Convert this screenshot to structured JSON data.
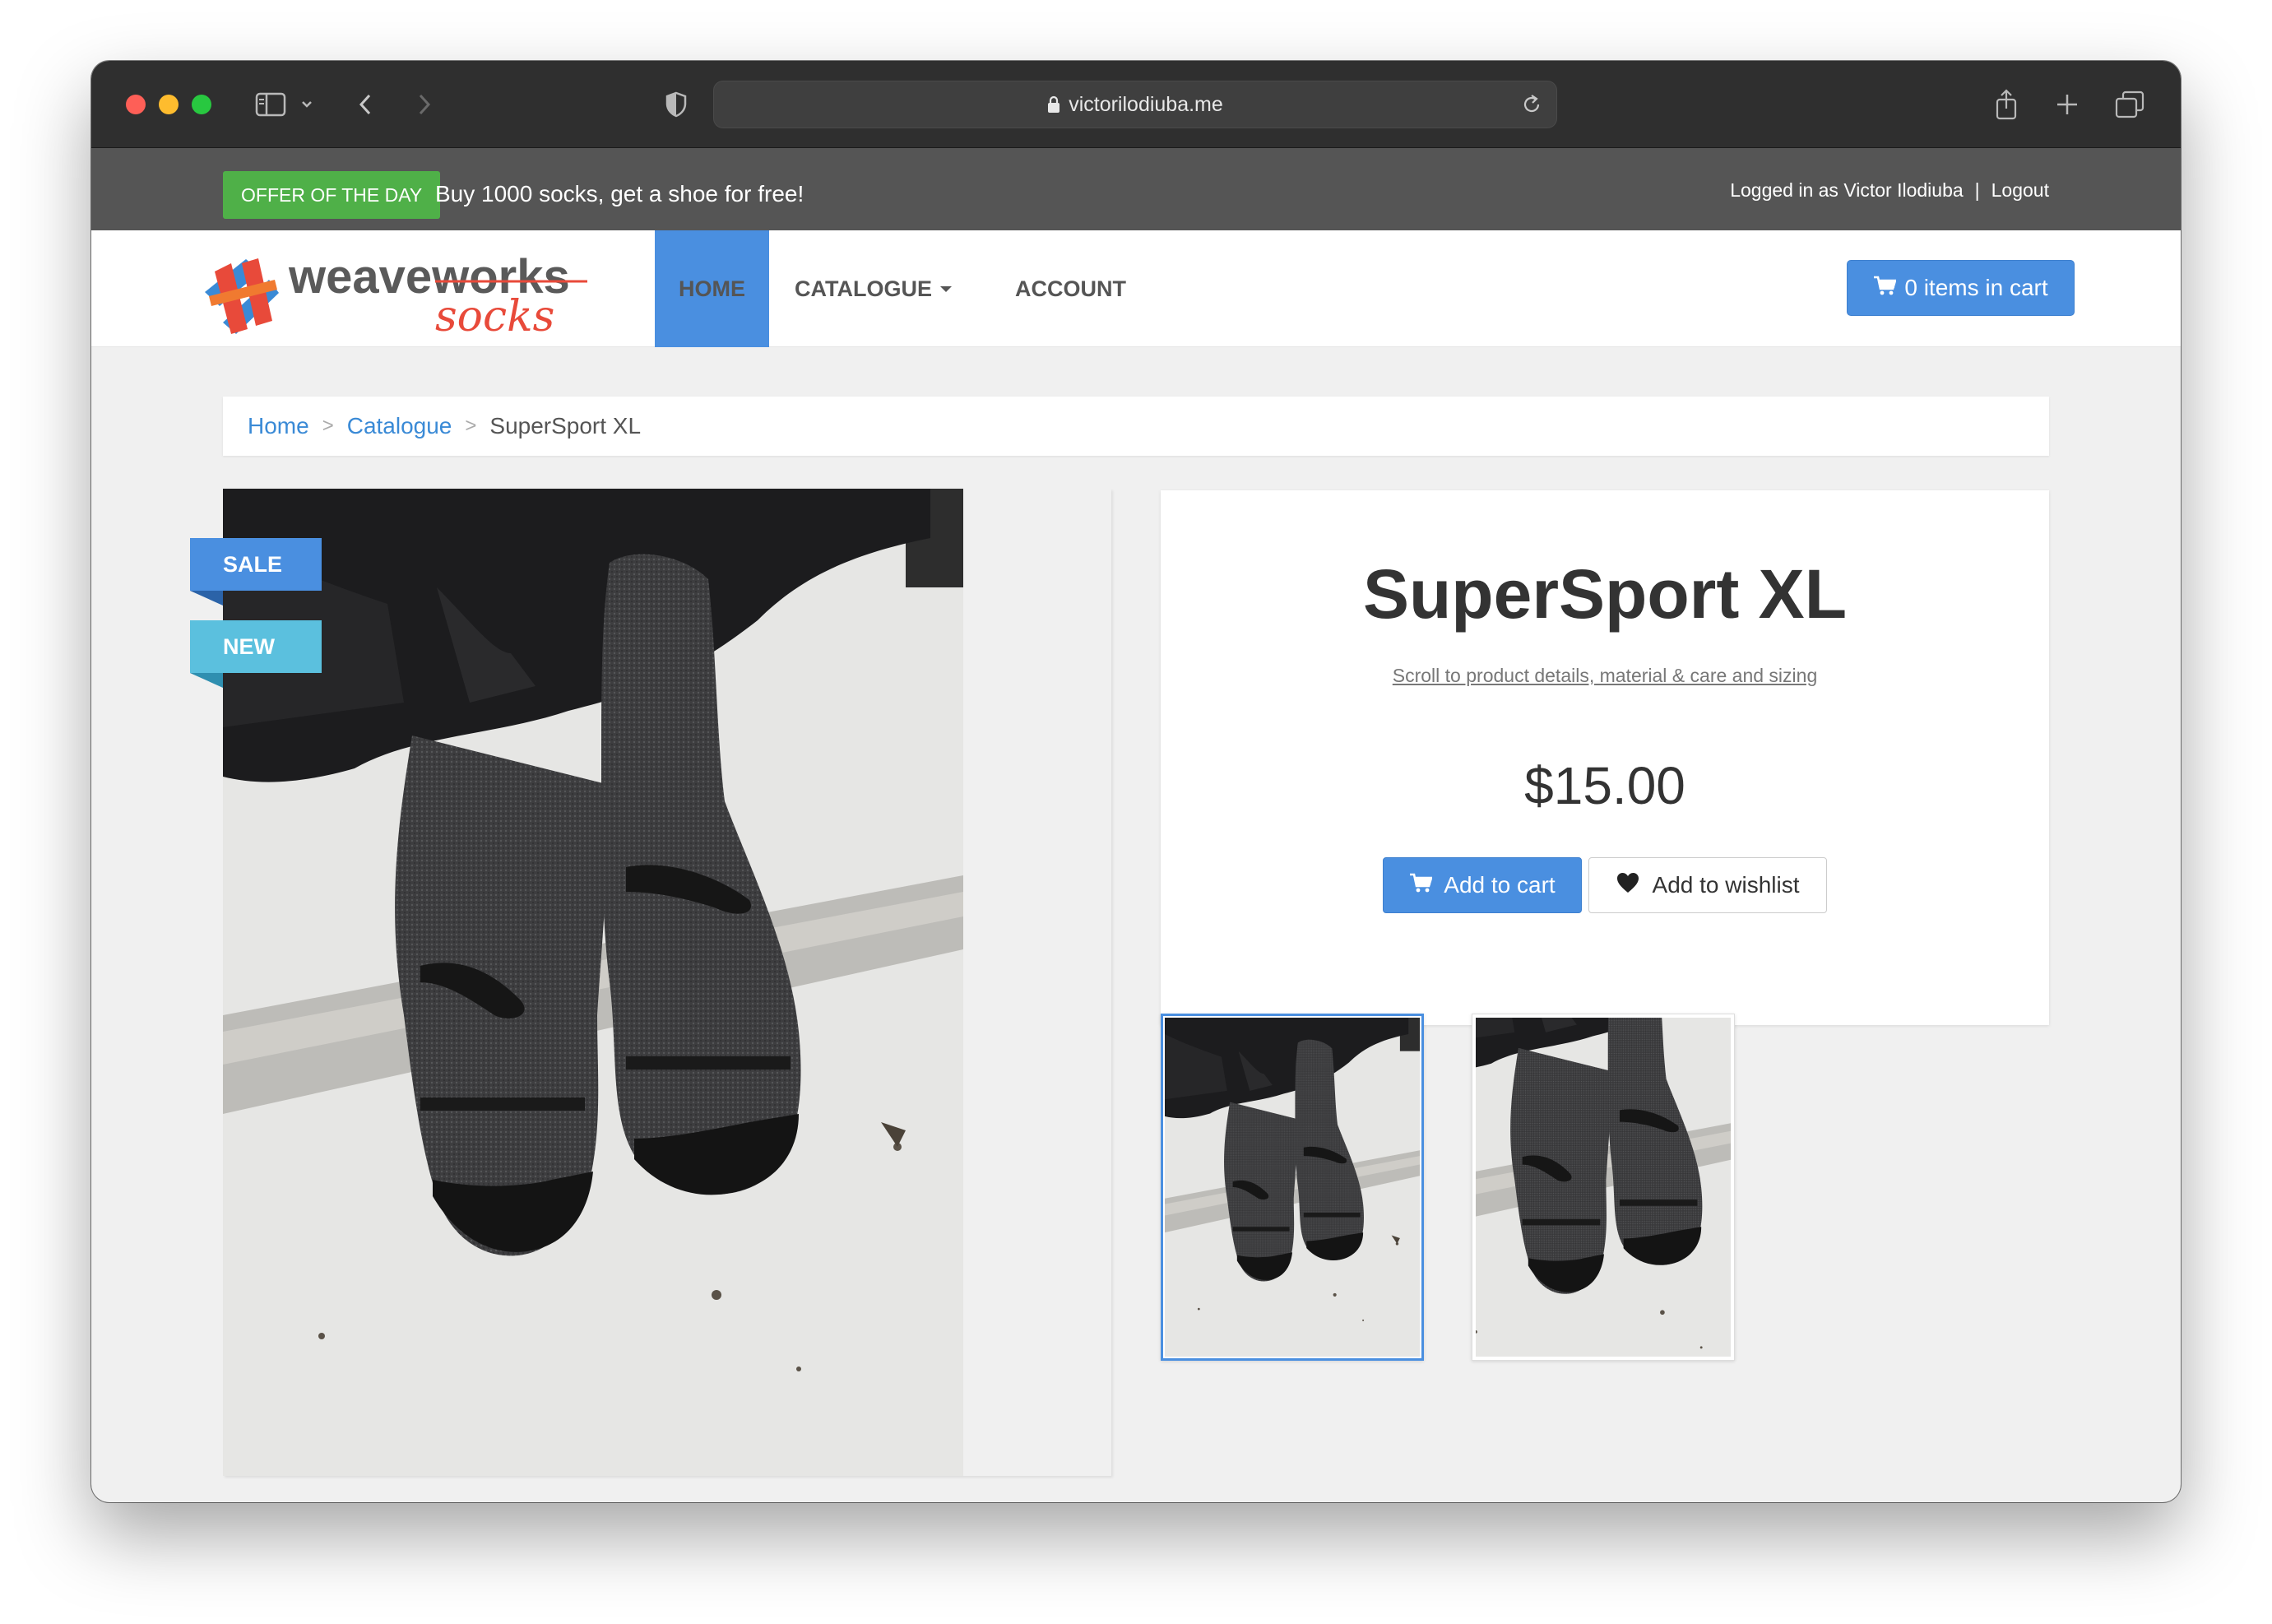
{
  "browser": {
    "url": "victorilodiuba.me"
  },
  "topbar": {
    "offer_badge": "OFFER OF THE DAY",
    "offer_text": "Buy 1000 socks, get a shoe for free!",
    "logged_in": "Logged in as Victor Ilodiuba",
    "separator": "|",
    "logout": "Logout"
  },
  "nav": {
    "logo_primary": "weaveworks",
    "logo_secondary": "socks",
    "items": [
      {
        "label": "HOME",
        "active": true
      },
      {
        "label": "CATALOGUE"
      },
      {
        "label": "ACCOUNT"
      }
    ],
    "cart_label": "0 items in cart"
  },
  "breadcrumb": {
    "home": "Home",
    "catalogue": "Catalogue",
    "current": "SuperSport XL",
    "sep": ">"
  },
  "product": {
    "ribbons": [
      "SALE",
      "NEW"
    ],
    "title": "SuperSport XL",
    "scroll_link": "Scroll to product details, material & care and sizing",
    "price": "$15.00",
    "add_to_cart": "Add to cart",
    "add_to_wishlist": "Add to wishlist"
  },
  "colors": {
    "accent": "#4a8fe0",
    "offer_green": "#4fb048",
    "topbar": "#555555",
    "logo_red": "#e84a3a"
  }
}
